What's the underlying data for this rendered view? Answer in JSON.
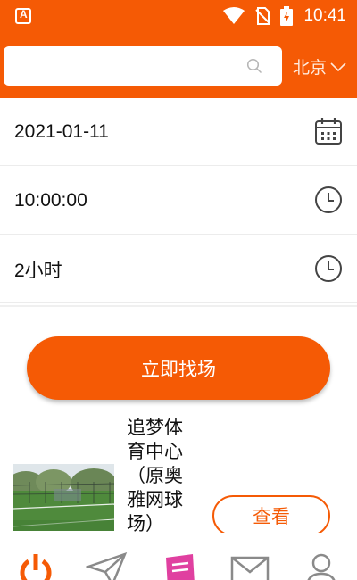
{
  "status_bar": {
    "time": "10:41",
    "icons": [
      "app-notification-icon",
      "wifi-icon",
      "no-sim-icon",
      "battery-charging-icon"
    ]
  },
  "header": {
    "search": {
      "value": "",
      "placeholder": "",
      "icon": "search-icon"
    },
    "city": "北京",
    "city_icon": "chevron-down-icon"
  },
  "form": {
    "date": {
      "value": "2021-01-11",
      "icon": "calendar-icon"
    },
    "time": {
      "value": "10:00:00",
      "icon": "clock-icon"
    },
    "duration": {
      "value": "2小时",
      "icon": "clock-icon"
    }
  },
  "actions": {
    "search_button": "立即找场"
  },
  "venues": [
    {
      "name": "追梦体育中心（原奥雅网球场）",
      "view_button": "查看"
    }
  ],
  "tab_bar": {
    "tabs": [
      {
        "icon": "power-icon"
      },
      {
        "icon": "send-icon"
      },
      {
        "icon": "document-icon",
        "active": true
      },
      {
        "icon": "mail-icon"
      },
      {
        "icon": "user-icon"
      }
    ]
  },
  "colors": {
    "brand": "#f55a05",
    "active_tab": "#e040a0"
  }
}
